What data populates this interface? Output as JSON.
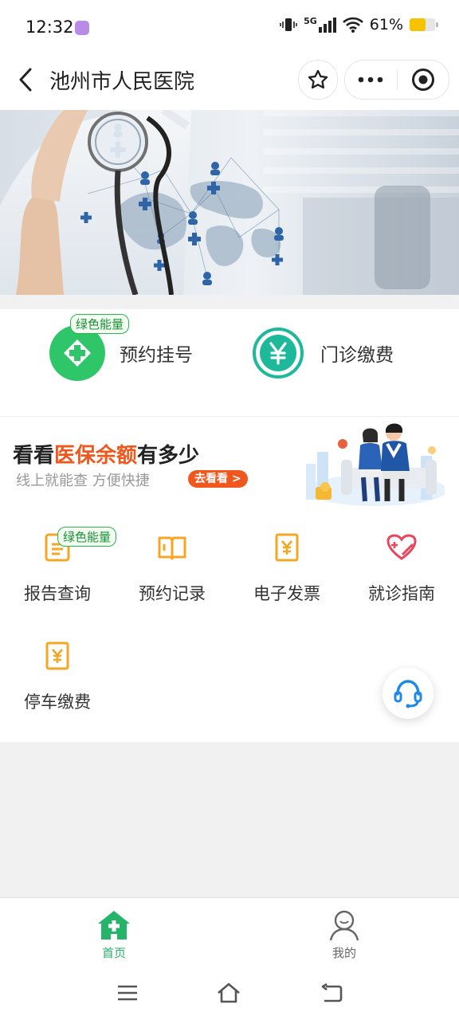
{
  "status_bar": {
    "time": "12:32",
    "network": "5G",
    "battery_percent": "61%",
    "battery_level": 0.61,
    "icons": [
      "app-badge-icon",
      "vibrate-icon",
      "signal-icon",
      "wifi-icon",
      "battery-icon"
    ]
  },
  "header": {
    "title": "池州市人民医院",
    "icons": [
      "back-icon",
      "star-icon",
      "more-icon",
      "target-icon"
    ]
  },
  "quick_actions": [
    {
      "label": "预约挂号",
      "badge": "绿色能量",
      "icon": "plus-icon",
      "color": "#2fc66a"
    },
    {
      "label": "门诊缴费",
      "badge": "",
      "icon": "yuan-icon",
      "color": "#1db99a"
    }
  ],
  "promo": {
    "title_prefix": "看看",
    "title_highlight": "医保余额",
    "title_suffix": "有多少",
    "subtitle": "线上就能查  方便快捷",
    "button": "去看看",
    "accent": "#f0571c"
  },
  "services": [
    {
      "label": "报告查询",
      "badge": "绿色能量",
      "icon": "report-icon"
    },
    {
      "label": "预约记录",
      "badge": "",
      "icon": "book-icon"
    },
    {
      "label": "电子发票",
      "badge": "",
      "icon": "invoice-icon"
    },
    {
      "label": "就诊指南",
      "badge": "",
      "icon": "heart-icon"
    },
    {
      "label": "停车缴费",
      "badge": "",
      "icon": "parking-invoice-icon"
    }
  ],
  "service_icon_color": "#f5a623",
  "tabbar": {
    "home": "首页",
    "mine": "我的",
    "active_color": "#25b46a"
  }
}
